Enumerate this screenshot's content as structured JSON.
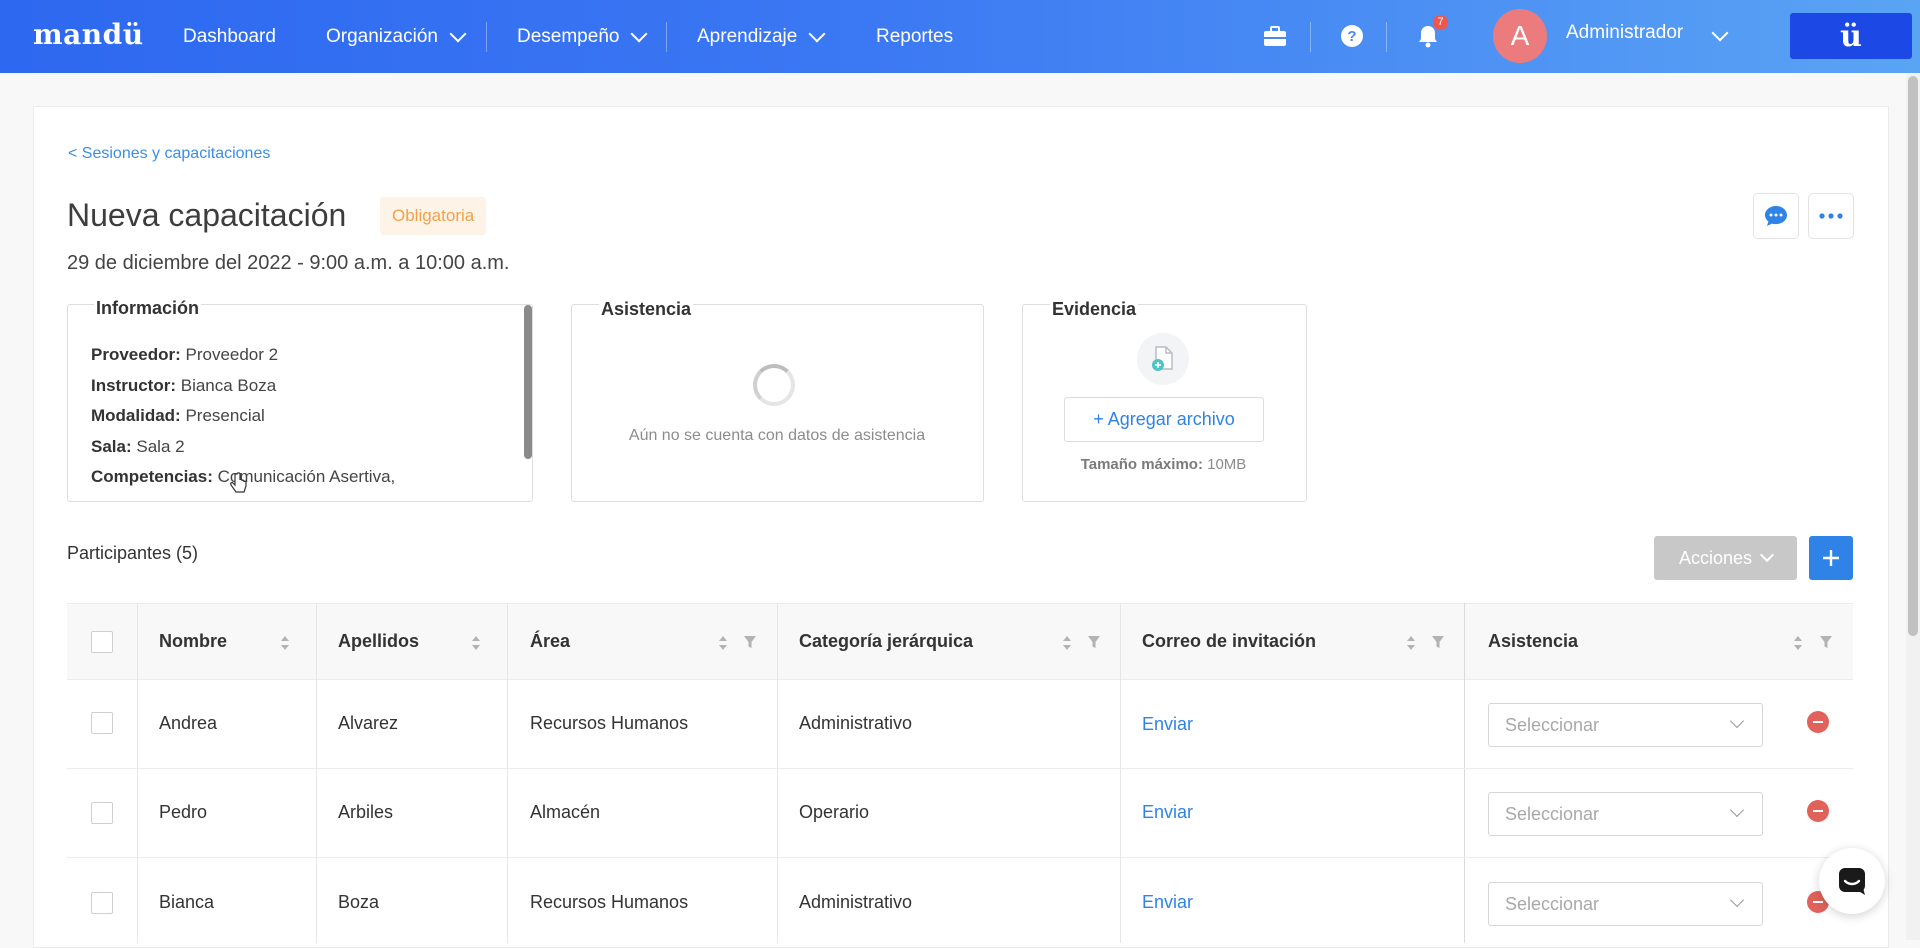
{
  "nav": {
    "logo": "mandü",
    "items": [
      "Dashboard",
      "Organización",
      "Desempeño",
      "Aprendizaje",
      "Reportes"
    ],
    "notifications_count": "7",
    "avatar_initial": "A",
    "user_name": "Administrador",
    "brand_button": "ü"
  },
  "page": {
    "breadcrumb": "< Sesiones y capacitaciones",
    "title": "Nueva capacitación",
    "badge": "Obligatoria",
    "date": "29 de diciembre del 2022 - 9:00 a.m. a 10:00 a.m."
  },
  "info": {
    "title": "Información",
    "lines": [
      {
        "label": "Proveedor:",
        "value": "Proveedor 2"
      },
      {
        "label": "Instructor:",
        "value": "Bianca Boza"
      },
      {
        "label": "Modalidad:",
        "value": "Presencial"
      },
      {
        "label": "Sala:",
        "value": "Sala 2"
      },
      {
        "label": "Competencias:",
        "value": "Comunicación Asertiva,"
      }
    ]
  },
  "attendance": {
    "title": "Asistencia",
    "empty": "Aún no se cuenta con datos de asistencia"
  },
  "evidence": {
    "title": "Evidencia",
    "add_file": "+ Agregar archivo",
    "max_label": "Tamaño máximo:",
    "max_value": "10MB"
  },
  "participants": {
    "title": "Participantes (5)",
    "actions_label": "Acciones",
    "columns": [
      "Nombre",
      "Apellidos",
      "Área",
      "Categoría jerárquica",
      "Correo de invitación",
      "Asistencia"
    ],
    "rows": [
      {
        "nombre": "Andrea",
        "apellidos": "Alvarez",
        "area": "Recursos Humanos",
        "categoria": "Administrativo",
        "correo": "Enviar",
        "asistencia": "Seleccionar"
      },
      {
        "nombre": "Pedro",
        "apellidos": "Arbiles",
        "area": "Almacén",
        "categoria": "Operario",
        "correo": "Enviar",
        "asistencia": "Seleccionar"
      },
      {
        "nombre": "Bianca",
        "apellidos": "Boza",
        "area": "Recursos Humanos",
        "categoria": "Administrativo",
        "correo": "Enviar",
        "asistencia": "Seleccionar"
      }
    ]
  },
  "colors": {
    "primary": "#2f83e6",
    "badge_text": "#f2a14b",
    "remove": "#e0625a"
  }
}
